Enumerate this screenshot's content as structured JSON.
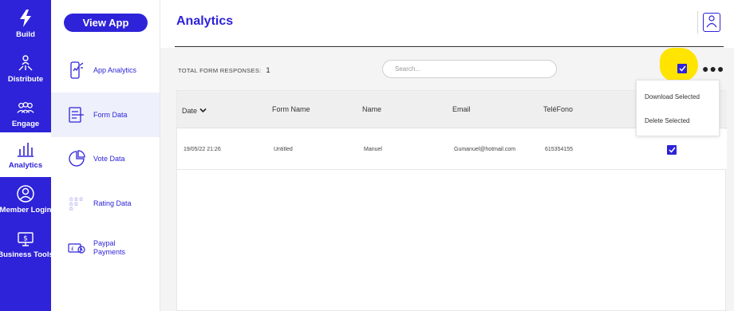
{
  "nav": {
    "items": [
      {
        "label": "Build",
        "icon": "bolt-icon"
      },
      {
        "label": "Distribute",
        "icon": "distribute-icon"
      },
      {
        "label": "Engage",
        "icon": "engage-icon"
      },
      {
        "label": "Analytics",
        "icon": "bar-chart-icon",
        "active": true
      },
      {
        "label": "Member Login",
        "icon": "user-circle-icon"
      },
      {
        "label": "Business Tools",
        "icon": "briefcase-dollar-icon"
      }
    ]
  },
  "sidebar": {
    "view_app_label": "View App",
    "items": [
      {
        "label": "App Analytics",
        "icon": "phone-analytics-icon"
      },
      {
        "label": "Form Data",
        "icon": "form-icon",
        "active": true
      },
      {
        "label": "Vote Data",
        "icon": "pie-chart-icon"
      },
      {
        "label": "Rating Data",
        "icon": "stars-icon"
      },
      {
        "label": "Paypal Payments",
        "icon": "payment-card-icon"
      }
    ]
  },
  "header": {
    "title": "Analytics"
  },
  "toolbar": {
    "total_label": "TOTAL FORM RESPONSES:",
    "total_count": "1",
    "search_placeholder": "Search..."
  },
  "table": {
    "columns": [
      "Date",
      "Form Name",
      "Name",
      "Email",
      "TeléFono"
    ],
    "rows": [
      {
        "date": "19/05/22 21:26",
        "form_name": "Untitled",
        "name": "Manuel",
        "email": "Gumanuel@hotmail.com",
        "telefono": "615354155",
        "selected": true
      }
    ]
  },
  "actions_menu": {
    "items": [
      "Download Selected",
      "Delete Selected"
    ]
  },
  "colors": {
    "brand": "#2e23d8",
    "highlight": "#ffe400"
  }
}
